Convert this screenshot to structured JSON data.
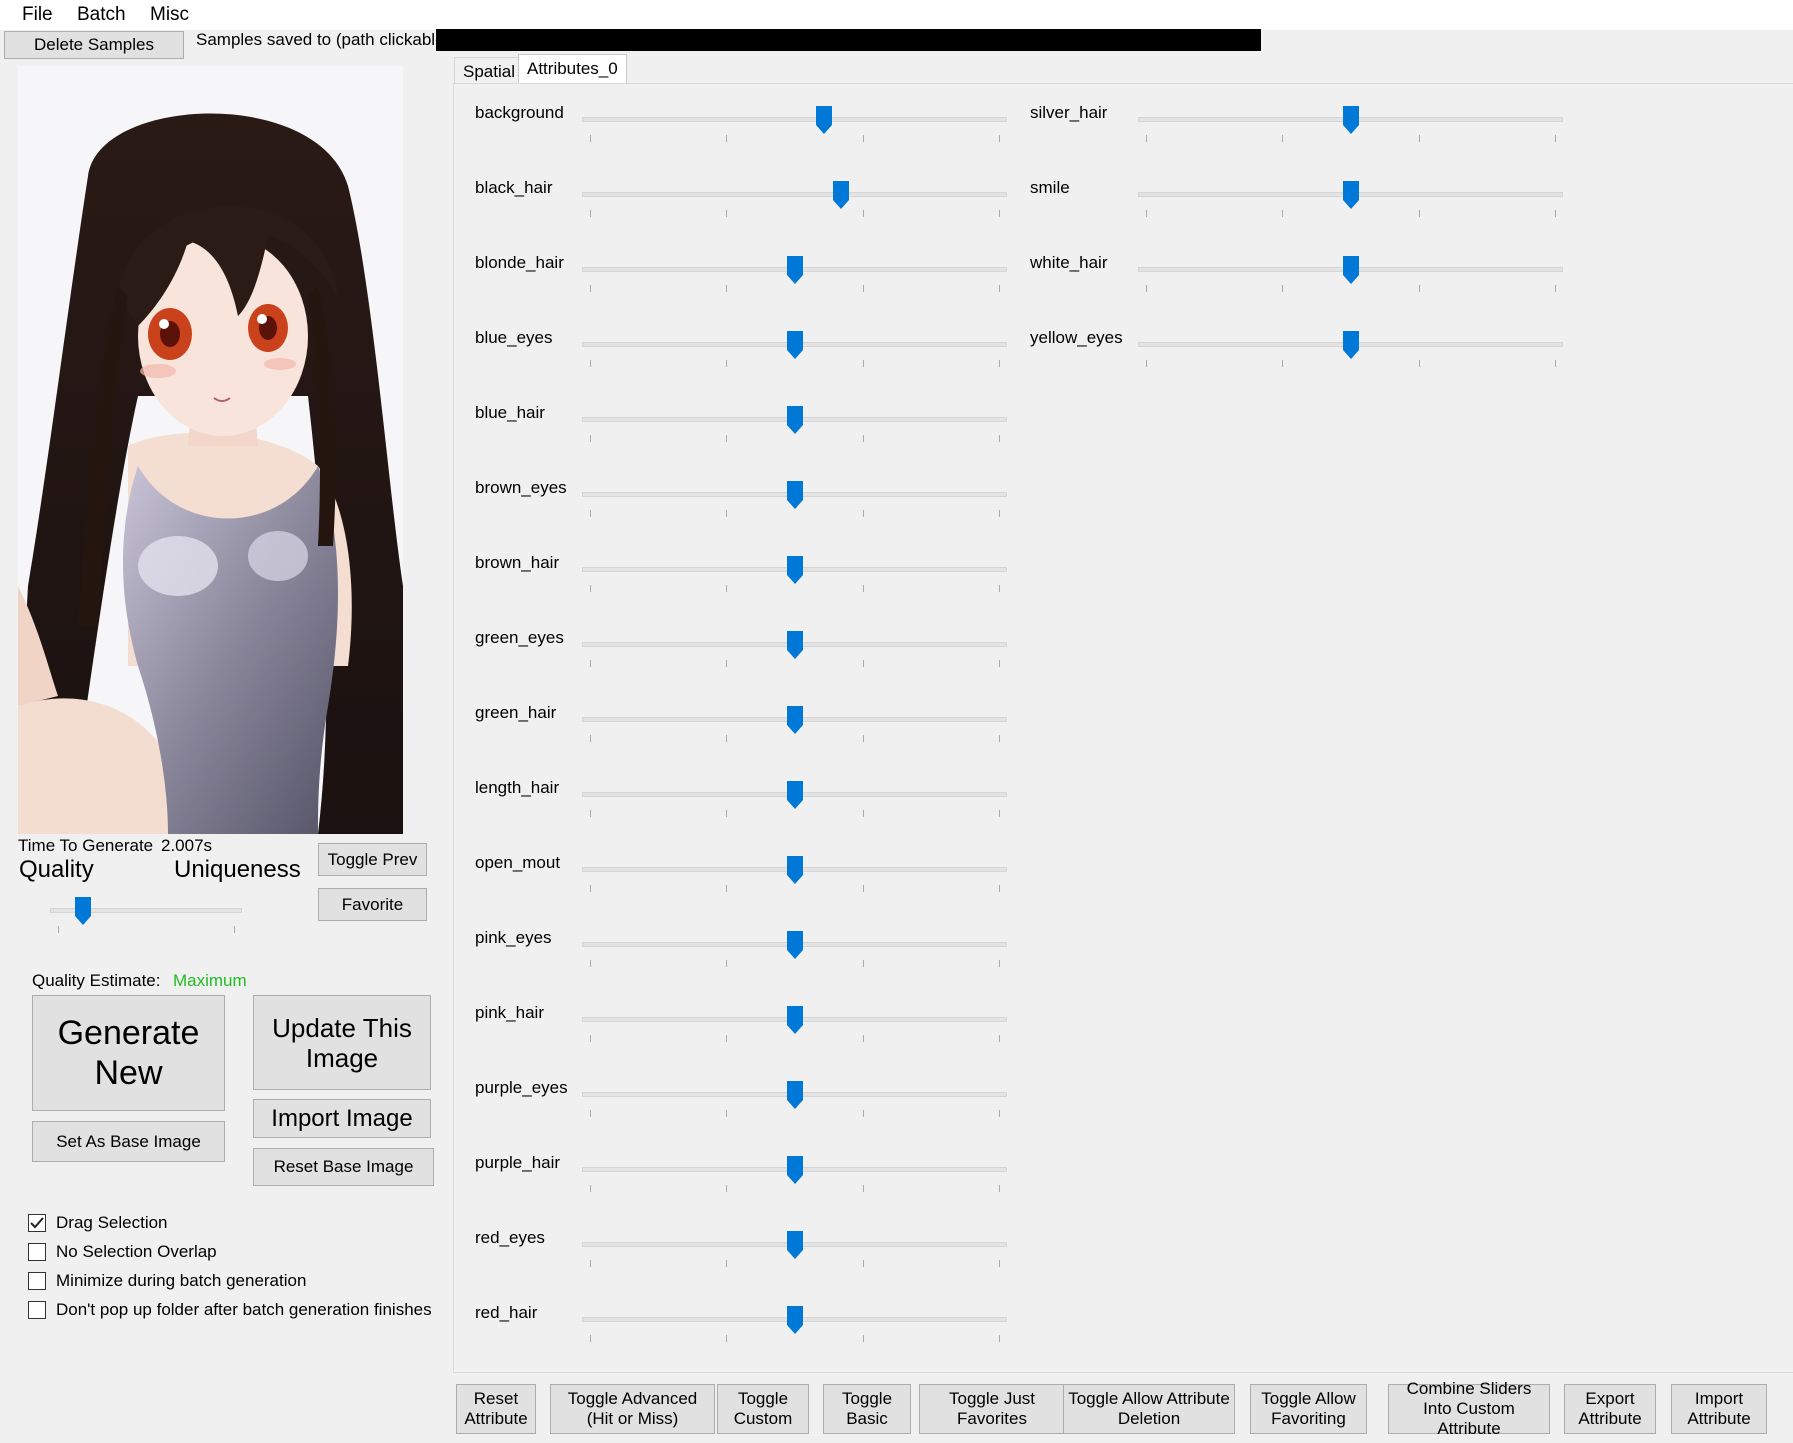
{
  "menu": {
    "items": [
      "File",
      "Batch",
      "Misc"
    ]
  },
  "toolbar": {
    "delete_samples": "Delete Samples",
    "samples_saved_label": "Samples saved to (path clickable):"
  },
  "generation": {
    "time_label": "Time To Generate",
    "time_value": "2.007s",
    "quality_label": "Quality",
    "uniqueness_label": "Uniqueness",
    "quality_slider_fraction": 0.17,
    "toggle_prev": "Toggle Prev",
    "favorite": "Favorite",
    "quality_estimate_label": "Quality Estimate:",
    "quality_estimate_value": "Maximum",
    "quality_estimate_color": "#22bb22",
    "generate_new": "Generate New",
    "update_this_image": "Update This Image",
    "import_image": "Import Image",
    "set_as_base_image": "Set As Base Image",
    "reset_base_image": "Reset Base Image"
  },
  "options": [
    {
      "label": "Drag Selection",
      "checked": true
    },
    {
      "label": "No Selection Overlap",
      "checked": false
    },
    {
      "label": "Minimize during batch generation",
      "checked": false
    },
    {
      "label": "Don't pop up folder after batch generation finishes",
      "checked": false
    }
  ],
  "tabs": [
    {
      "label": "Spatial",
      "active": false
    },
    {
      "label": "Attributes_0",
      "active": true
    }
  ],
  "accent_color": "#0078d7",
  "attributes": [
    {
      "name": "background",
      "value": 0.57
    },
    {
      "name": "black_hair",
      "value": 0.61
    },
    {
      "name": "blonde_hair",
      "value": 0.5
    },
    {
      "name": "blue_eyes",
      "value": 0.5
    },
    {
      "name": "blue_hair",
      "value": 0.5
    },
    {
      "name": "brown_eyes",
      "value": 0.5
    },
    {
      "name": "brown_hair",
      "value": 0.5
    },
    {
      "name": "green_eyes",
      "value": 0.5
    },
    {
      "name": "green_hair",
      "value": 0.5
    },
    {
      "name": "length_hair",
      "value": 0.5
    },
    {
      "name": "open_mout",
      "value": 0.5
    },
    {
      "name": "pink_eyes",
      "value": 0.5
    },
    {
      "name": "pink_hair",
      "value": 0.5
    },
    {
      "name": "purple_eyes",
      "value": 0.5
    },
    {
      "name": "purple_hair",
      "value": 0.5
    },
    {
      "name": "red_eyes",
      "value": 0.5
    },
    {
      "name": "red_hair",
      "value": 0.5
    },
    {
      "name": "silver_hair",
      "value": 0.5
    },
    {
      "name": "smile",
      "value": 0.5
    },
    {
      "name": "white_hair",
      "value": 0.5
    },
    {
      "name": "yellow_eyes",
      "value": 0.5
    }
  ],
  "bottom_buttons": [
    "Reset Attribute",
    "Toggle Advanced (Hit or Miss)",
    "Toggle Custom",
    "Toggle Basic",
    "Toggle Just Favorites",
    "Toggle Allow Attribute Deletion",
    "Toggle Allow Favoriting",
    "Combine Sliders Into Custom Attribute",
    "Export Attribute",
    "Import Attribute"
  ]
}
